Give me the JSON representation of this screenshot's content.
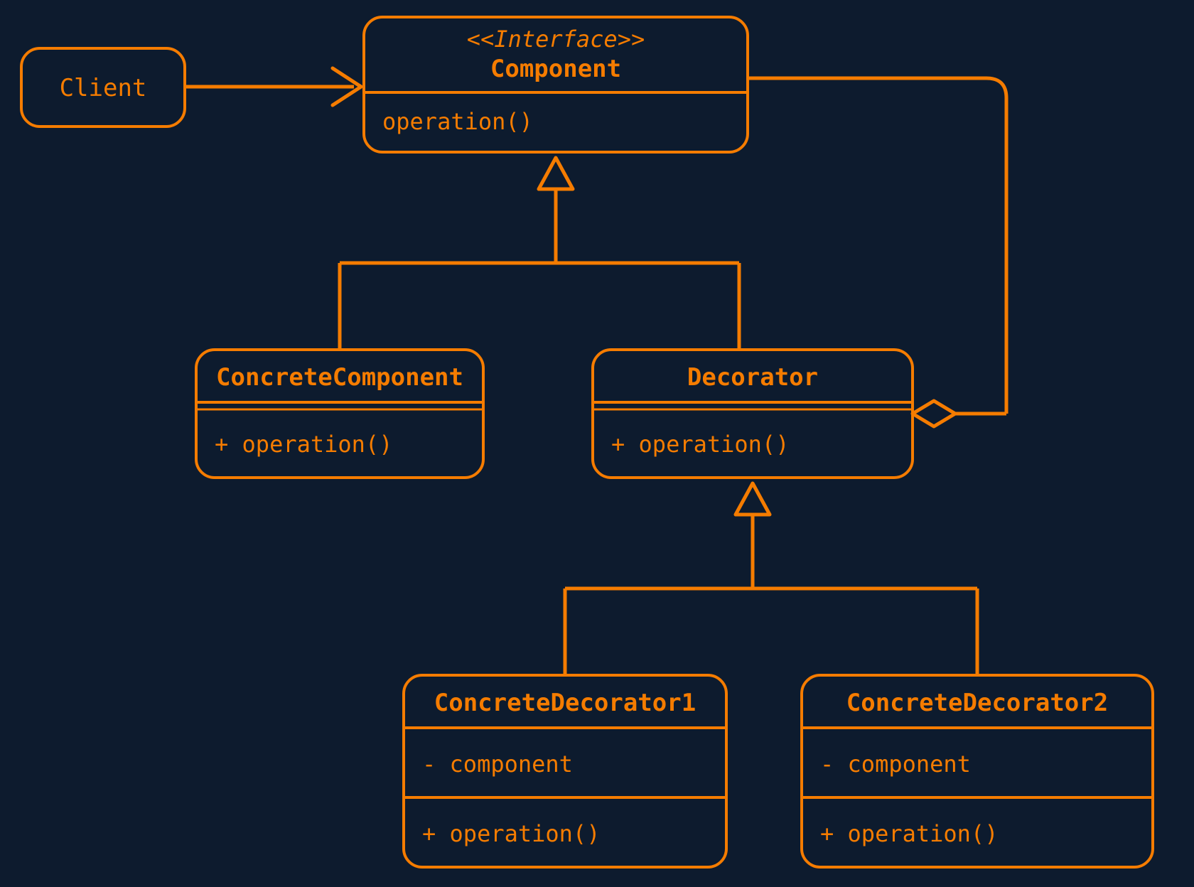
{
  "colors": {
    "bg": "#0d1b2e",
    "accent": "#f57c00"
  },
  "client": {
    "label": "Client"
  },
  "component": {
    "stereotype": "<<Interface>>",
    "name": "Component",
    "operation": "operation()"
  },
  "concreteComponent": {
    "name": "ConcreteComponent",
    "operation": "+ operation()"
  },
  "decorator": {
    "name": "Decorator",
    "operation": "+ operation()"
  },
  "concreteDecorator1": {
    "name": "ConcreteDecorator1",
    "field": "- component",
    "operation": "+ operation()"
  },
  "concreteDecorator2": {
    "name": "ConcreteDecorator2",
    "field": "- component",
    "operation": "+ operation()"
  },
  "chart_data": {
    "type": "uml-class-diagram",
    "pattern": "Decorator",
    "nodes": [
      {
        "id": "Client",
        "kind": "class"
      },
      {
        "id": "Component",
        "kind": "interface",
        "members": [
          "operation()"
        ]
      },
      {
        "id": "ConcreteComponent",
        "kind": "class",
        "members": [
          "+ operation()"
        ]
      },
      {
        "id": "Decorator",
        "kind": "class",
        "members": [
          "+ operation()"
        ]
      },
      {
        "id": "ConcreteDecorator1",
        "kind": "class",
        "fields": [
          "- component"
        ],
        "members": [
          "+ operation()"
        ]
      },
      {
        "id": "ConcreteDecorator2",
        "kind": "class",
        "fields": [
          "- component"
        ],
        "members": [
          "+ operation()"
        ]
      }
    ],
    "edges": [
      {
        "from": "Client",
        "to": "Component",
        "type": "association"
      },
      {
        "from": "ConcreteComponent",
        "to": "Component",
        "type": "generalization"
      },
      {
        "from": "Decorator",
        "to": "Component",
        "type": "generalization"
      },
      {
        "from": "ConcreteDecorator1",
        "to": "Decorator",
        "type": "generalization"
      },
      {
        "from": "ConcreteDecorator2",
        "to": "Decorator",
        "type": "generalization"
      },
      {
        "from": "Decorator",
        "to": "Component",
        "type": "aggregation"
      }
    ]
  }
}
